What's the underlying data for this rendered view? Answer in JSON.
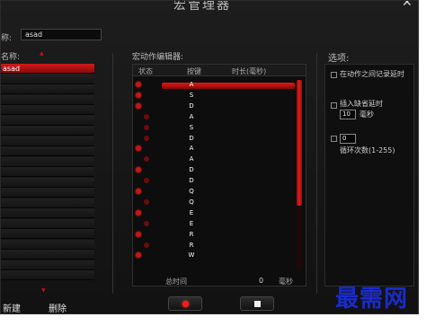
{
  "window": {
    "title": "宏管理器",
    "close_symbol": "✕"
  },
  "name_field": {
    "label": "称:",
    "value": "asad"
  },
  "macro_list": {
    "title": "名称:",
    "items": [
      "asad",
      "",
      "",
      "",
      "",
      "",
      "",
      "",
      "",
      "",
      "",
      "",
      "",
      "",
      "",
      "",
      "",
      "",
      "",
      "",
      ""
    ]
  },
  "actions": {
    "new_label": "新建",
    "delete_label": "删除"
  },
  "editor": {
    "title": "宏动作编辑器:",
    "columns": {
      "status": "状态",
      "key": "按键",
      "duration": "时长(毫秒)"
    },
    "rows": [
      {
        "key": "A",
        "state": "down"
      },
      {
        "key": "S",
        "state": "down"
      },
      {
        "key": "D",
        "state": "down"
      },
      {
        "key": "A",
        "state": "up"
      },
      {
        "key": "S",
        "state": "up"
      },
      {
        "key": "D",
        "state": "up"
      },
      {
        "key": "A",
        "state": "down"
      },
      {
        "key": "A",
        "state": "up"
      },
      {
        "key": "D",
        "state": "down"
      },
      {
        "key": "D",
        "state": "up"
      },
      {
        "key": "Q",
        "state": "down"
      },
      {
        "key": "Q",
        "state": "up"
      },
      {
        "key": "E",
        "state": "down"
      },
      {
        "key": "E",
        "state": "up"
      },
      {
        "key": "R",
        "state": "down"
      },
      {
        "key": "R",
        "state": "up"
      },
      {
        "key": "W",
        "state": "down"
      }
    ],
    "total_label": "总时间",
    "total_value": "0",
    "total_unit": "毫秒"
  },
  "options": {
    "title": "选项:",
    "record_delay": "在动作之间记录延时",
    "insert_delay": "插入缺省延时",
    "insert_delay_value": "10",
    "insert_delay_unit": "毫秒",
    "loop_value": "0",
    "loop_label": "循环次数(1-255)"
  },
  "watermark": "最需网",
  "colors": {
    "accent": "#d21a1a",
    "background": "#161616",
    "watermark": "#1a2bc9"
  }
}
